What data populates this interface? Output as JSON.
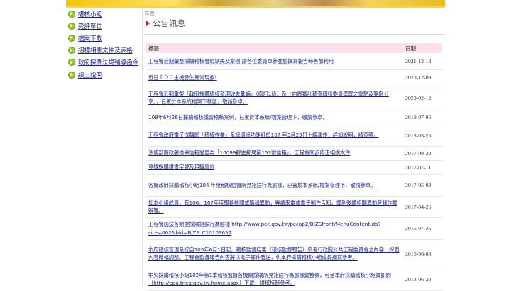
{
  "sidebar": {
    "items": [
      {
        "label": "權核小組"
      },
      {
        "label": "受評單位"
      },
      {
        "label": "檔案下載"
      },
      {
        "label": "招標相關文件及表格"
      },
      {
        "label": "政府採購法規輔導函令"
      },
      {
        "label": "線上說明"
      }
    ]
  },
  "header": {
    "breadcrumb": "首頁",
    "title": "公告訊息"
  },
  "table": {
    "col_title": "標題",
    "col_date": "日期",
    "rows": [
      {
        "title": "工程會近期彙整採購稽核發現缺失及案例 請各位委員卓參並於撰寫報告時善加利用",
        "date": "2021-12-13"
      },
      {
        "title": "近日ＩＤＣ主機發生異常現象!",
        "date": "2020-12-09"
      },
      {
        "title": "工程會近期彙整「政府採購稽核發現缺失彙編」（修訂1版）及「向農審計稽查稽核委員學習之重點及案例分享」，已置於本系統檔案下載區，敬請參卓。",
        "date": "2020-02-12"
      },
      {
        "title": "108年6月26日採購稽核講習稽核案例，已置於本系統/檔案管理下，敬請參卓。",
        "date": "2019-07-05"
      },
      {
        "title": "工程會政府電子採購網「稽核作業」系統增修功能訂於107 年3月23日上線運作，詳如說明，請查照。",
        "date": "2018-03-26"
      },
      {
        "title": "法務部廉政署檢舉信箱變更為「10099郵史郵局第153號信箱」，工程會同步修正相撲文件",
        "date": "2017-09-22"
      },
      {
        "title": "登錄採購證書字號及現職單位",
        "date": "2017-07-11"
      },
      {
        "title": "各縣政府採購稽核小組104 年度稽核監督所見錯誤行為態樣，已置於本系統/檔案管理下，敬請參卓。",
        "date": "2017-05-03"
      },
      {
        "title": "如本小組成員，有106、107年度服務機關或職稱異動，專請來電或電子郵件告知，俾利後續相關異動登錄作業辦理。",
        "date": "2017-04-26"
      },
      {
        "title": "工程會函送各類型採購錯誤行為態樣 http://www.pcc.gov.tw/pccap2/BIZSfront/MenuContent.do?site=002&bid=BIZS_C10103657",
        "date": "2016-07-26"
      },
      {
        "title": "本府稽核管理系統自105年6月1日起，稽核監督結果（稽核監督報告）參考行政院公共工程委員會之內容，採面內容微幅調整。工程會監督報告內容將以電子郵件發送，供本府採購稽核小組成員擷寫參考。",
        "date": "2016-06-03"
      },
      {
        "title": "中央採購稽核小組102年第1季稽核監督各機關採購所見錯誤行為態樣彙整表，可至本府採購稽核小組資訊網（http://epa.tncg.gov.tw.home.aspx）下載，供稽核時參考。",
        "date": "2013-06-20"
      }
    ]
  },
  "colors": {
    "accent": "#c62828",
    "link": "#1a237e",
    "header_bg": "#fbe0ee",
    "bullet": "#9acd32",
    "banner": "#f1c40f"
  }
}
